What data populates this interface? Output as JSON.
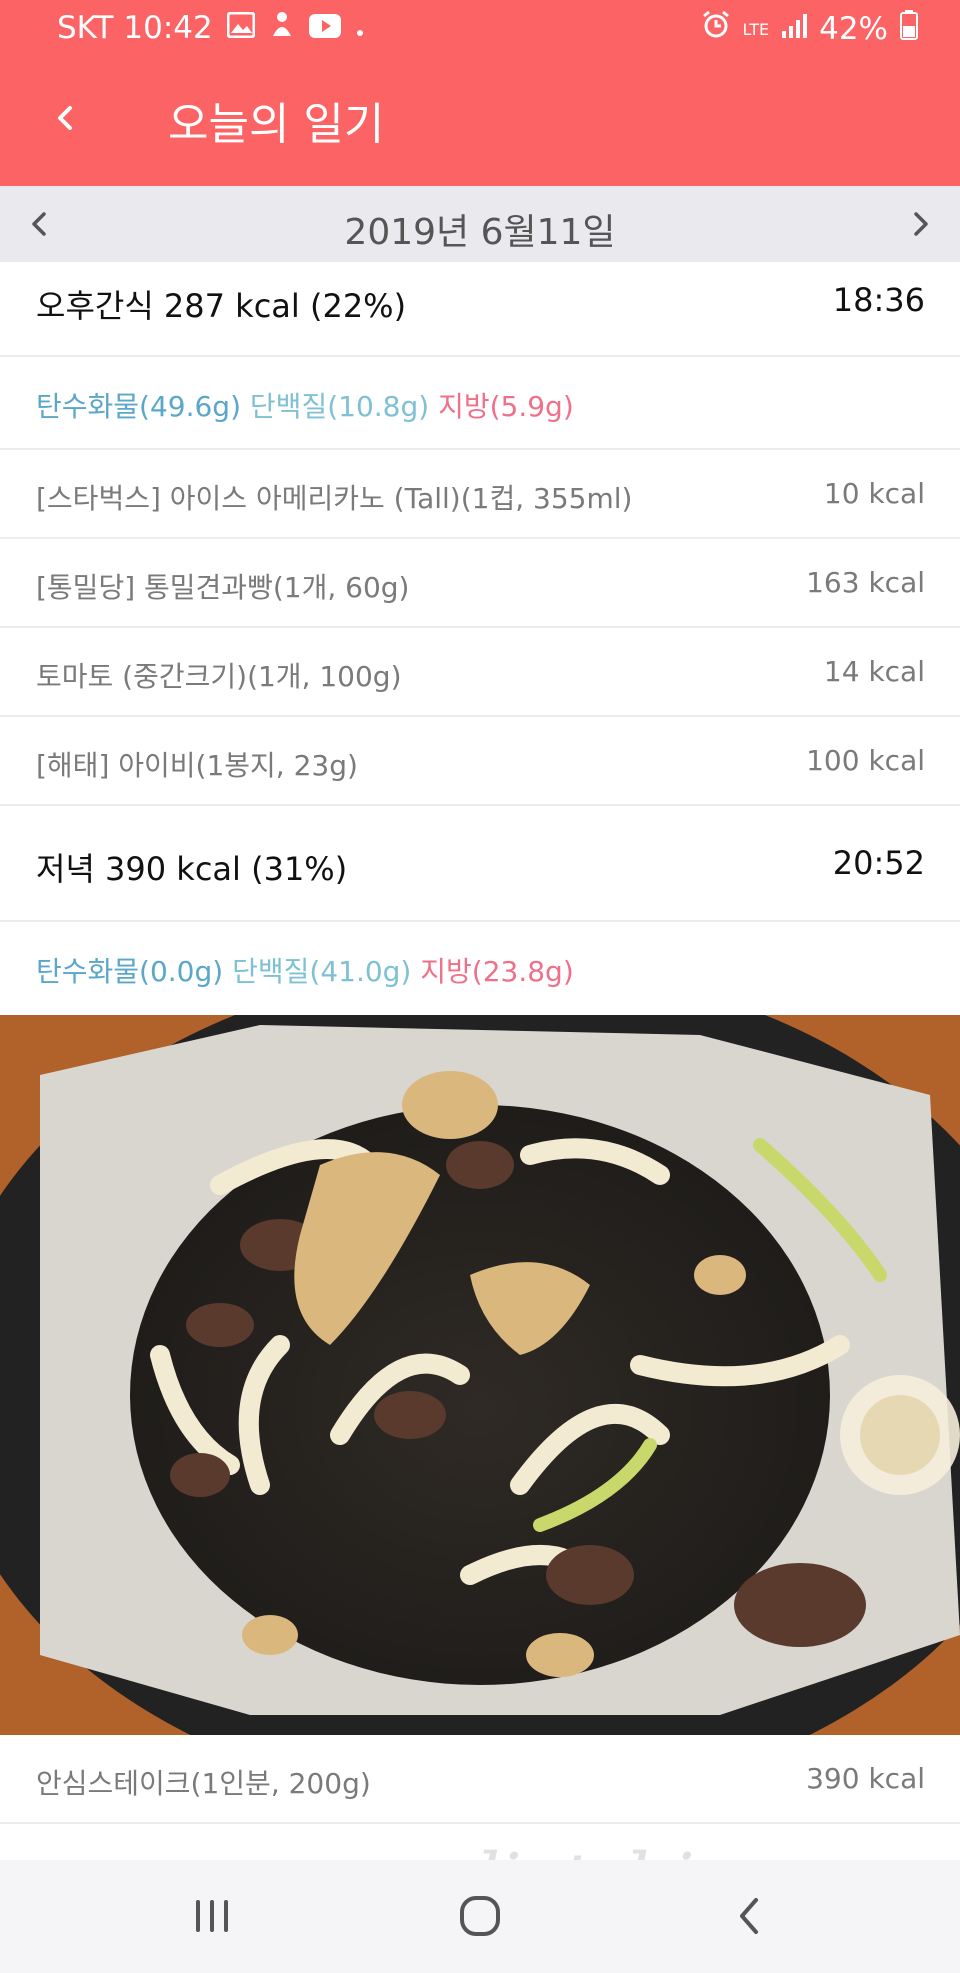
{
  "status_bar": {
    "carrier_time": "SKT 10:42",
    "network": "LTE",
    "battery": "42%"
  },
  "app_bar": {
    "title": "오늘의 일기"
  },
  "date_bar": {
    "date": "2019년 6월11일"
  },
  "sections": {
    "snack": {
      "header": "오후간식 287 kcal (22%)",
      "time": "18:36",
      "macros": {
        "carb": "탄수화물(49.6g)",
        "protein": "단백질(10.8g)",
        "fat": "지방(5.9g)"
      },
      "items": [
        {
          "name": "[스타벅스] 아이스 아메리카노 (Tall)(1컵, 355ml)",
          "kcal": "10 kcal"
        },
        {
          "name": "[통밀당] 통밀견과빵(1개, 60g)",
          "kcal": "163 kcal"
        },
        {
          "name": "토마토 (중간크기)(1개, 100g)",
          "kcal": "14 kcal"
        },
        {
          "name": "[해태] 아이비(1봉지, 23g)",
          "kcal": "100 kcal"
        }
      ]
    },
    "dinner": {
      "header": "저녁 390 kcal (31%)",
      "time": "20:52",
      "macros": {
        "carb": "탄수화물(0.0g)",
        "protein": "단백질(41.0g)",
        "fat": "지방(23.8g)"
      },
      "items": [
        {
          "name": "안심스테이크(1인분, 200g)",
          "kcal": "390 kcal"
        }
      ]
    }
  },
  "watermark": "dietshin.com",
  "colors": {
    "header": "#fb6365",
    "carb": "#5aa7c9",
    "protein": "#7fc1d4",
    "fat": "#f0708a"
  }
}
